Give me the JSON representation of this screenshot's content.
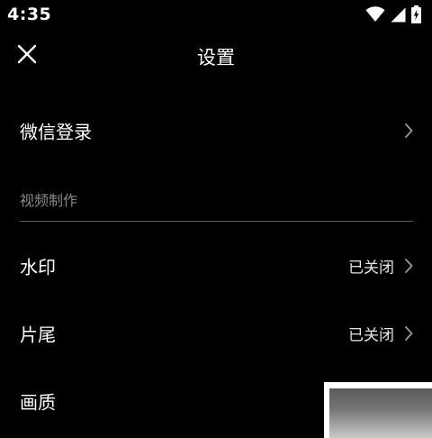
{
  "status_bar": {
    "time": "4:35",
    "icons": [
      "wifi-icon",
      "cellular-signal-icon",
      "battery-charging-icon"
    ]
  },
  "top_bar": {
    "close_icon": "close-icon",
    "title": "设置"
  },
  "settings": {
    "wechat_login": {
      "label": "微信登录"
    },
    "video_section": {
      "header": "视频制作"
    },
    "watermark": {
      "label": "水印",
      "value": "已关闭"
    },
    "ending": {
      "label": "片尾",
      "value": "已关闭"
    },
    "quality": {
      "label": "画质"
    }
  },
  "colors": {
    "background": "#000000",
    "text_primary": "#ffffff",
    "text_secondary": "#8a8a8a",
    "chevron": "#9a9a9a",
    "divider": "#5a5a5a"
  }
}
